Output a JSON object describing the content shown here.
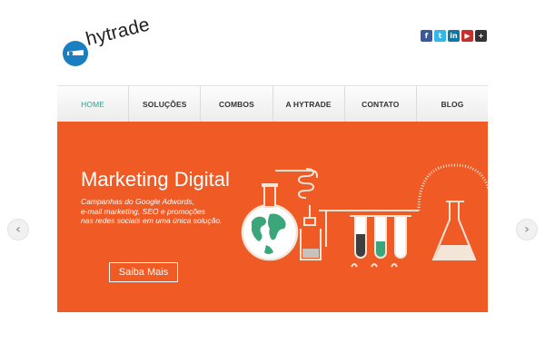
{
  "brand": {
    "name": "hytrade"
  },
  "social": [
    {
      "icon": "facebook-icon",
      "glyph": "f",
      "color": "#3b5998"
    },
    {
      "icon": "twitter-icon",
      "glyph": "t",
      "color": "#2fb8e8"
    },
    {
      "icon": "linkedin-icon",
      "glyph": "in",
      "color": "#0e76a8"
    },
    {
      "icon": "youtube-icon",
      "glyph": "▶",
      "color": "#c4302b"
    },
    {
      "icon": "more-icon",
      "glyph": "+",
      "color": "#333333"
    }
  ],
  "nav": {
    "items": [
      "HOME",
      "SOLUÇÕES",
      "COMBOS",
      "A HYTRADE",
      "CONTATO",
      "BLOG"
    ],
    "active": "HOME"
  },
  "slide": {
    "headline": "Marketing Digital",
    "lines": [
      "Campanhas do Google Adwords,",
      "e-mail marketing, SEO e promoções",
      "nas redes sociais em uma única solução."
    ],
    "cta": "Saiba Mais",
    "background": "#f05a24"
  },
  "slider": {
    "prev": "‹",
    "next": "›"
  }
}
